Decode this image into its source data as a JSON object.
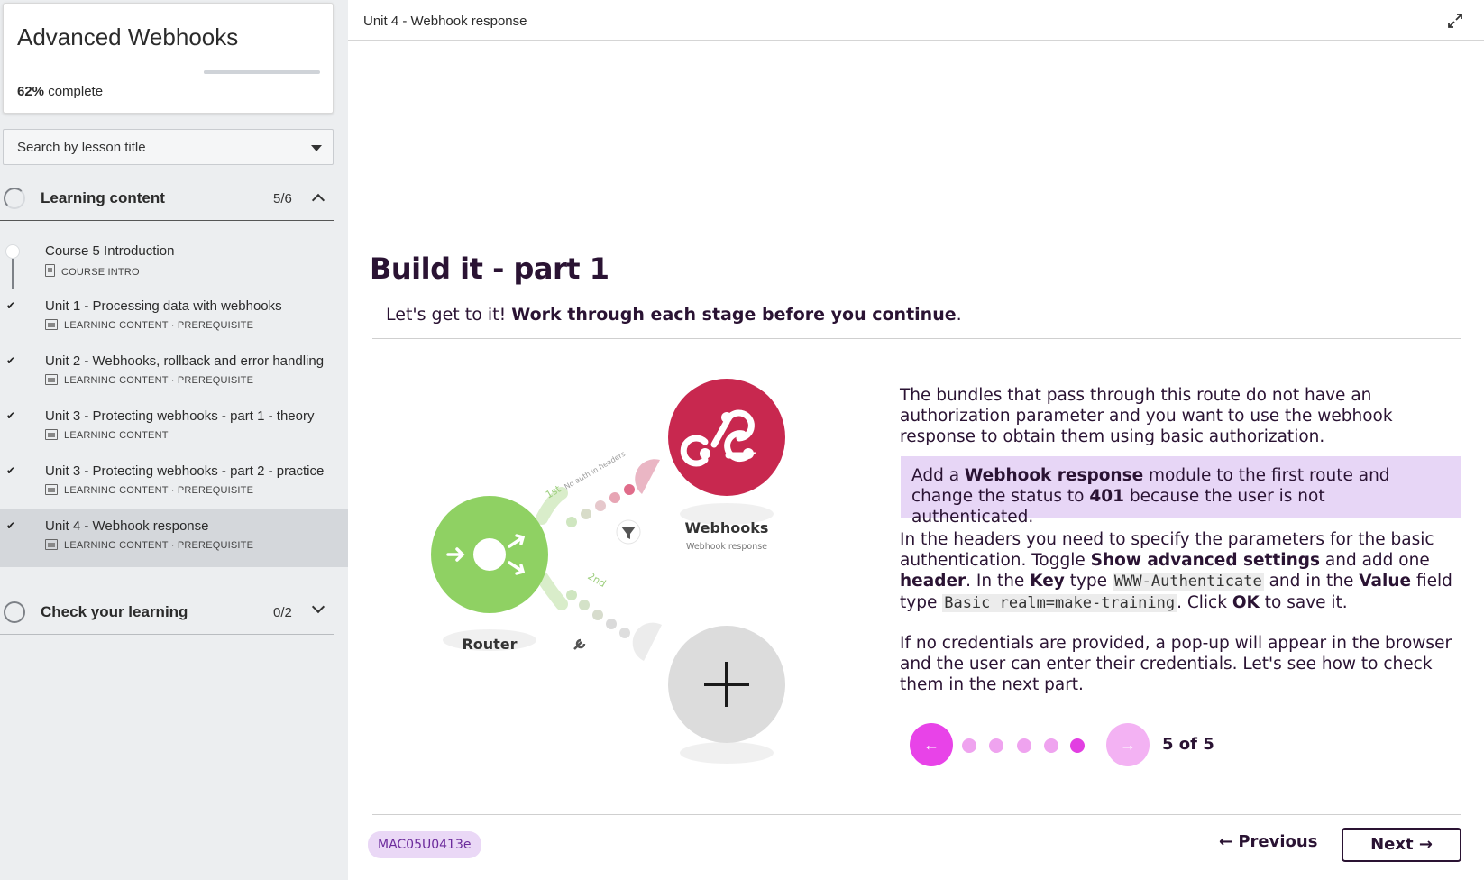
{
  "course": {
    "title": "Advanced Webhooks",
    "progress_percent": "62%",
    "progress_suffix": "complete",
    "progress_fraction": 0.62
  },
  "search": {
    "label": "Search by lesson title"
  },
  "sections": [
    {
      "title": "Learning content",
      "count": "5/6",
      "expanded": true,
      "lessons": [
        {
          "title": "Course 5 Introduction",
          "meta": "COURSE INTRO",
          "done": false,
          "icon": "document-icon"
        },
        {
          "title": "Unit 1 - Processing data with webhooks",
          "meta": "LEARNING CONTENT · PREREQUISITE",
          "done": true,
          "icon": "slides-icon"
        },
        {
          "title": "Unit 2 - Webhooks, rollback and error handling",
          "meta": "LEARNING CONTENT · PREREQUISITE",
          "done": true,
          "icon": "slides-icon"
        },
        {
          "title": "Unit 3 - Protecting webhooks - part 1 - theory",
          "meta": "LEARNING CONTENT",
          "done": true,
          "icon": "slides-icon"
        },
        {
          "title": "Unit 3 - Protecting webhooks - part 2 - practice",
          "meta": "LEARNING CONTENT · PREREQUISITE",
          "done": true,
          "icon": "slides-icon"
        },
        {
          "title": "Unit 4 - Webhook response",
          "meta": "LEARNING CONTENT · PREREQUISITE",
          "done": true,
          "active": true,
          "icon": "slides-icon"
        }
      ]
    },
    {
      "title": "Check your learning",
      "count": "0/2",
      "expanded": false
    }
  ],
  "header": {
    "unit_title": "Unit 4 - Webhook response"
  },
  "content": {
    "heading": "Build it - part 1",
    "intro_plain": "Let's get to it! ",
    "intro_bold": "Work through each stage before you continue",
    "intro_end": ".",
    "diagram": {
      "router_label": "Router",
      "webhooks_label": "Webhooks",
      "webhooks_sub": "Webhook response",
      "route1_label": "1st",
      "route1_note": "No auth in headers",
      "route2_label": "2nd"
    },
    "p1": "The bundles that pass through this route do not have an authorization parameter and you want to use the webhook response to obtain them using basic authorization.",
    "p2": {
      "t1": "Add a ",
      "b1": "Webhook response",
      "t2": " module to the first route and change the status to ",
      "b2": "401",
      "t3": " because the user is not authenticated."
    },
    "p3": {
      "t1": "In the headers you need to specify the parameters for the basic authentication. Toggle ",
      "b1": "Show advanced settings",
      "t2": " and add one ",
      "b2": "header",
      "t3": ". In the ",
      "b3": "Key",
      "t4": " type ",
      "c1": "WWW-Authenticate",
      "t5": " and in the ",
      "b4": "Value",
      "t6": " field type ",
      "c2": "Basic realm=make-training",
      "t7": ". Click ",
      "b5": "OK",
      "t8": " to save it."
    },
    "p4": "If no credentials are provided, a pop-up will appear in the browser and the user can enter their credentials. Let's see how to check them in the next part.",
    "carousel": {
      "counter": "5 of 5",
      "current": 5,
      "total": 5
    }
  },
  "footer": {
    "code": "MAC05U0413e",
    "previous": "← Previous",
    "next": "Next →"
  },
  "colors": {
    "accent": "#e843e8",
    "heading": "#2a1333",
    "highlight": "#e7d6f6",
    "router_green": "#8fd163",
    "webhooks_pink": "#c8284f"
  }
}
